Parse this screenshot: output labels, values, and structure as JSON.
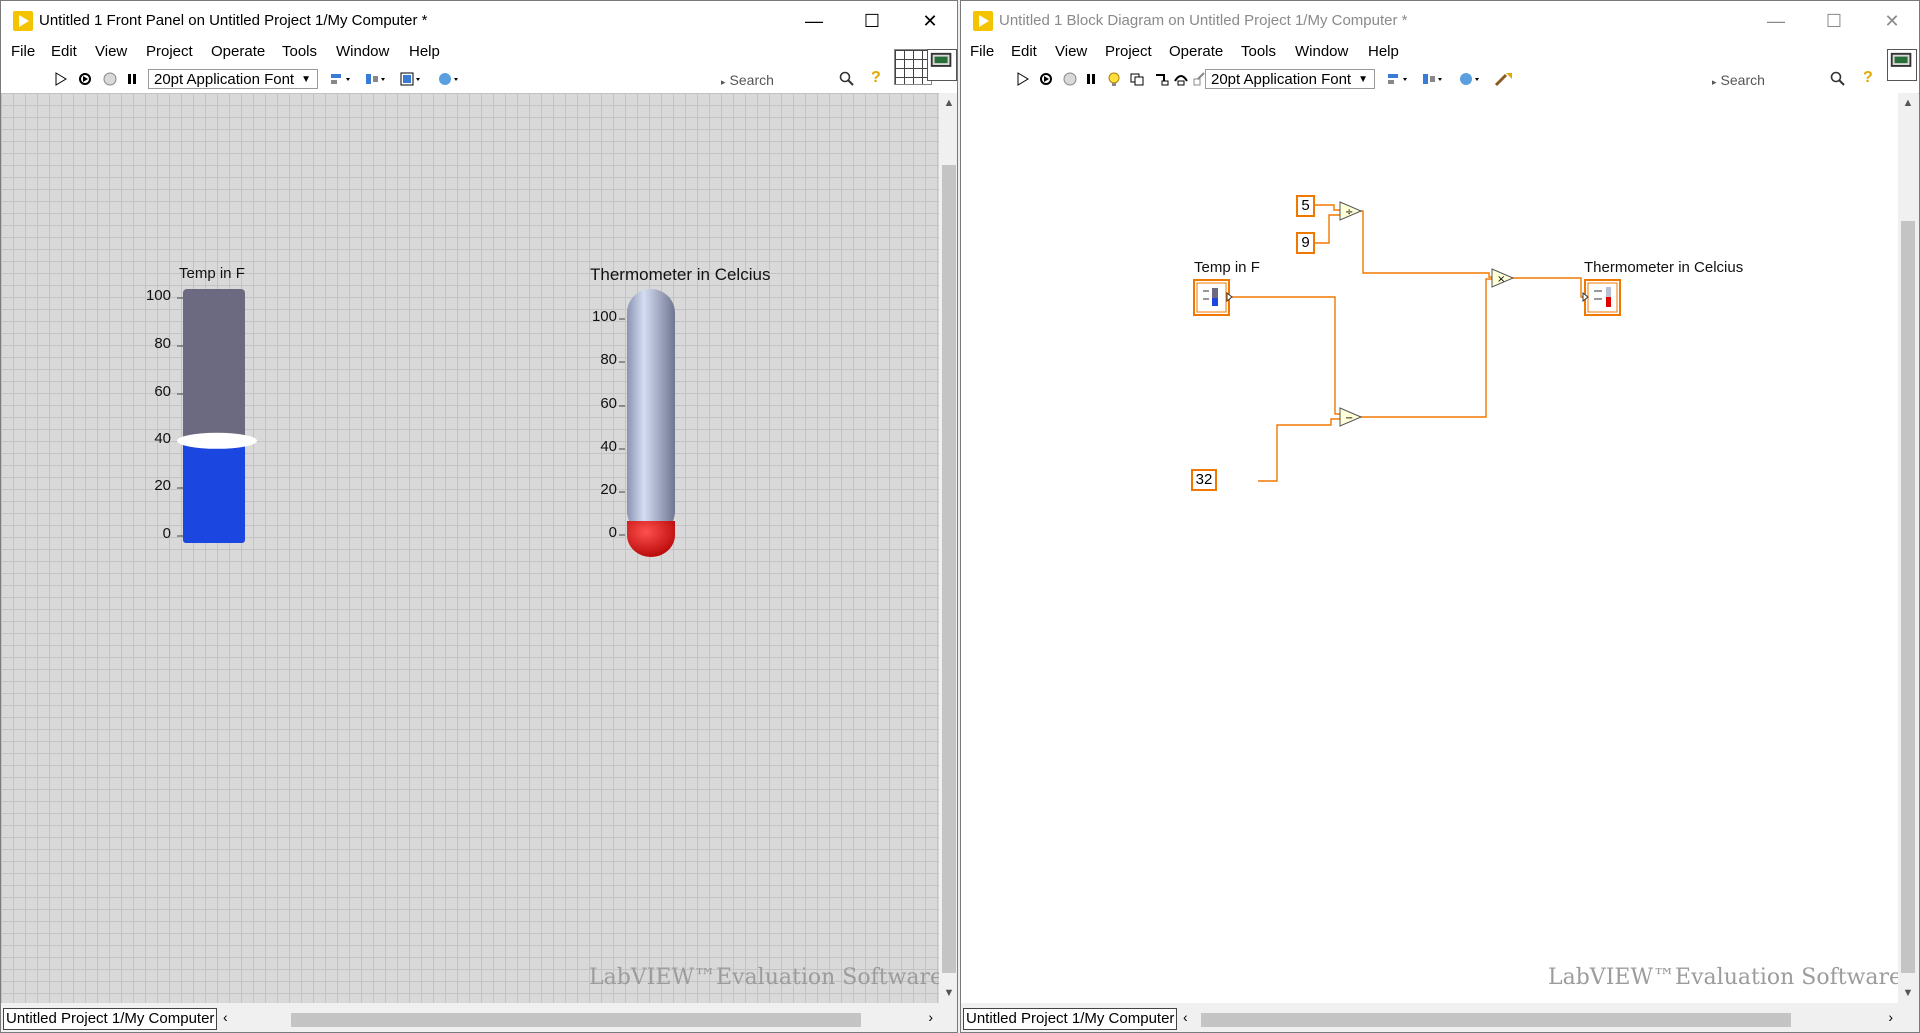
{
  "front_panel": {
    "title": "Untitled 1 Front Panel on Untitled Project 1/My Computer *",
    "menu": [
      "File",
      "Edit",
      "View",
      "Project",
      "Operate",
      "Tools",
      "Window",
      "Help"
    ],
    "font_select": "20pt Application Font",
    "search_placeholder": "Search",
    "status_text": "Untitled Project 1/My Computer",
    "watermark": "LabVIEW™Evaluation Software",
    "tank": {
      "label": "Temp in F",
      "ticks": [
        "100",
        "80",
        "60",
        "40",
        "20",
        "0"
      ],
      "range": [
        0,
        100
      ],
      "value": 40,
      "fill_color": "#1c46e0",
      "empty_color": "#6b6a80"
    },
    "thermometer": {
      "label": "Thermometer in Celcius",
      "ticks": [
        "100",
        "80",
        "60",
        "40",
        "20",
        "0"
      ],
      "range": [
        0,
        100
      ],
      "value": 4,
      "fill_color": "#e00000"
    }
  },
  "block_diagram": {
    "title": "Untitled 1 Block Diagram on Untitled Project 1/My Computer *",
    "menu": [
      "File",
      "Edit",
      "View",
      "Project",
      "Operate",
      "Tools",
      "Window",
      "Help"
    ],
    "font_select": "20pt Application Font",
    "search_placeholder": "Search",
    "status_text": "Untitled Project 1/My Computer",
    "watermark": "LabVIEW™Evaluation Software",
    "constants": {
      "five": "5",
      "nine": "9",
      "thirty_two": "32"
    },
    "terminals": {
      "input_label": "Temp in F",
      "output_label": "Thermometer in Celcius"
    },
    "operators": {
      "divide": "÷",
      "multiply": "×",
      "subtract": "−"
    },
    "wire_color": "#f07800"
  }
}
